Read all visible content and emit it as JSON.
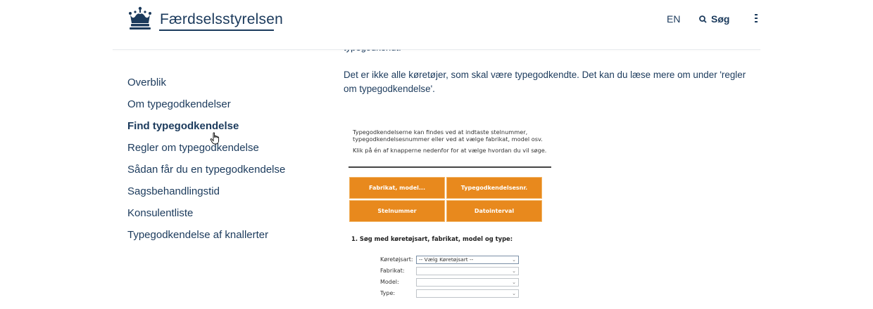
{
  "header": {
    "logo_text": "Færdselsstyrelsen",
    "lang": "EN",
    "search_label": "Søg"
  },
  "content": {
    "cut_text": "typegodkendt.",
    "intro": "Det er ikke alle køretøjer, som skal være typegodkendte. Det kan du læse mere om under 'regler om typegodkendelse'."
  },
  "sidebar": {
    "items": [
      {
        "label": "Overblik"
      },
      {
        "label": "Om typegodkendelser"
      },
      {
        "label": "Find typegodkendelse"
      },
      {
        "label": "Regler om typegodkendelse"
      },
      {
        "label": "Sådan får du en typegodkendelse"
      },
      {
        "label": "Sagsbehandlingstid"
      },
      {
        "label": "Konsulentliste"
      },
      {
        "label": "Typegodkendelse af knallerter"
      }
    ],
    "active_index": 2
  },
  "embed": {
    "text1": "Typegodkendelserne kan findes ved at indtaste stelnummer, typegodkendelsesnummer eller ved at vælge fabrikat, model osv.",
    "text2": "Klik på én af knapperne nedenfor for at vælge hvordan du vil søge.",
    "buttons": [
      "Fabrikat, model...",
      "Typegodkendelsesnr.",
      "Stelnummer",
      "Datointerval"
    ],
    "section_title": "1. Søg med køretøjsart, fabrikat, model og type:",
    "fields": [
      {
        "label": "Køretøjsart:",
        "value": "-- Vælg Køretøjsart --"
      },
      {
        "label": "Fabrikat:",
        "value": ""
      },
      {
        "label": "Model:",
        "value": ""
      },
      {
        "label": "Type:",
        "value": ""
      }
    ]
  },
  "colors": {
    "brand": "#1b3a5c",
    "orange": "#e8891d"
  }
}
